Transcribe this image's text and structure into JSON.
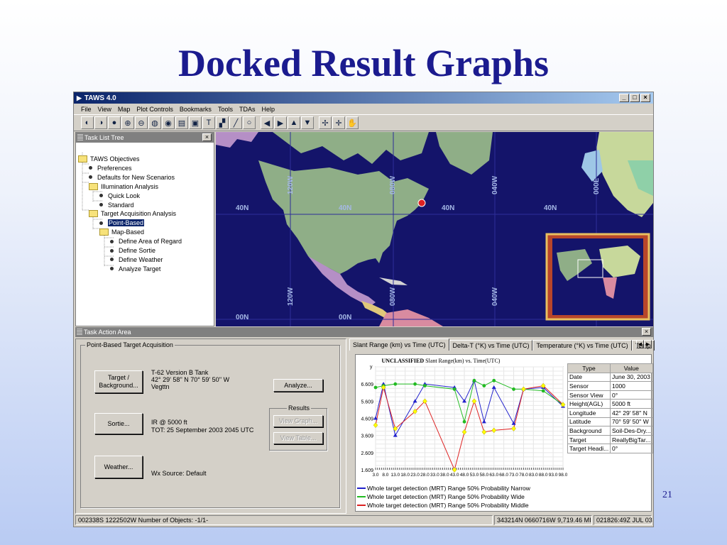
{
  "slide": {
    "title": "Docked Result Graphs",
    "number": "21"
  },
  "window": {
    "title": "TAWS 4.0",
    "controls": [
      "_",
      "□",
      "×"
    ],
    "menu": [
      "File",
      "View",
      "Map",
      "Plot Controls",
      "Bookmarks",
      "Tools",
      "TDAs",
      "Help"
    ]
  },
  "task_tree": {
    "title": "Task List Tree",
    "close": "×",
    "nodes": [
      {
        "label": "TAWS Objectives",
        "kind": "folder",
        "indent": 0
      },
      {
        "label": "Preferences",
        "kind": "leaf",
        "indent": 1
      },
      {
        "label": "Defaults for New Scenarios",
        "kind": "leaf",
        "indent": 1
      },
      {
        "label": "Illumination Analysis",
        "kind": "folder",
        "indent": 1
      },
      {
        "label": "Quick Look",
        "kind": "leaf",
        "indent": 2
      },
      {
        "label": "Standard",
        "kind": "leaf",
        "indent": 2
      },
      {
        "label": "Target Acquisition Analysis",
        "kind": "folder",
        "indent": 1
      },
      {
        "label": "Point-Based",
        "kind": "leaf",
        "indent": 2,
        "selected": true
      },
      {
        "label": "Map-Based",
        "kind": "folder",
        "indent": 2
      },
      {
        "label": "Define Area of Regard",
        "kind": "leaf",
        "indent": 3
      },
      {
        "label": "Define Sortie",
        "kind": "leaf",
        "indent": 3
      },
      {
        "label": "Define Weather",
        "kind": "leaf",
        "indent": 3
      },
      {
        "label": "Analyze Target",
        "kind": "leaf",
        "indent": 3
      }
    ]
  },
  "map": {
    "labels_lat": [
      "40N",
      "40N",
      "40N",
      "40N",
      "00N",
      "00N"
    ],
    "labels_lon": [
      "120W",
      "080W",
      "040W",
      "000E",
      "120W",
      "080W",
      "040W"
    ],
    "colors": {
      "ocean": "#14146a",
      "north_america": "#8fae87",
      "mexico": "#b58fc6"
    }
  },
  "action_area": {
    "title": "Task Action Area",
    "close": "×",
    "group_title": "Point-Based Target Acquisition",
    "target_button": "Target / Background...",
    "target_info": [
      "T-62 Version B Tank",
      "42° 29' 58'' N  70° 59' 50'' W",
      "Vegttn"
    ],
    "analyze_button": "Analyze...",
    "results_title": "Results",
    "view_graph": "View Graph...",
    "view_table": "View Table...",
    "sortie_button": "Sortie...",
    "sortie_info": [
      "IR @   5000 ft",
      "TOT: 25 September 2003 2045 UTC"
    ],
    "weather_button": "Weather...",
    "weather_info": "Wx Source: Default"
  },
  "graph_panel": {
    "tabs": [
      "Slant Range (km) vs Time (UTC)",
      "Delta-T (°K) vs Time (UTC)",
      "Temperature (°K) vs Time (UTC)",
      "Temp"
    ],
    "plot_title_bold": "UNCLASSIFIED",
    "plot_title_rest": " Slant Range(km) vs. Time(UTC)",
    "table_headers": [
      "Type",
      "Value"
    ],
    "table_rows": [
      [
        "Date",
        "June 30, 2003"
      ],
      [
        "Sensor",
        "1000"
      ],
      [
        "Sensor View",
        "0°"
      ],
      [
        "Height(AGL)",
        "5000 ft"
      ],
      [
        "Longitude",
        "42° 29' 58'' N"
      ],
      [
        "Latitude",
        "70° 59' 50'' W"
      ],
      [
        "Background",
        "Soil-Des-Dry..."
      ],
      [
        "Target",
        "ReallyBigTar..."
      ],
      [
        "Target Headi...",
        "0°"
      ]
    ]
  },
  "chart_data": {
    "type": "line",
    "xlabel": "",
    "ylabel": "",
    "y_axis_label": "y",
    "ylim": [
      1.609,
      7.609
    ],
    "yticks": [
      "6.609",
      "5.609",
      "4.609",
      "3.609",
      "2.609",
      "1.609"
    ],
    "xticks": [
      "3.0",
      "8.0",
      "13.0",
      "18.0",
      "23.0",
      "28.0",
      "33.0",
      "38.0",
      "43.0",
      "48.0",
      "53.0",
      "58.0",
      "63.0",
      "68.0",
      "73.0",
      "78.0",
      "83.0",
      "88.0",
      "93.0",
      "98.0"
    ],
    "x": [
      3,
      7,
      13,
      23,
      28,
      43,
      48,
      53,
      58,
      63,
      73,
      78,
      88,
      98
    ],
    "series": [
      {
        "name": "Whole target detection (MRT) Range  50% Probability  Narrow",
        "color": "#2222cc",
        "values": [
          4.609,
          6.609,
          3.609,
          5.609,
          6.609,
          6.409,
          5.609,
          6.809,
          4.409,
          6.409,
          4.309,
          6.309,
          6.409,
          5.309
        ]
      },
      {
        "name": "Whole target detection (MRT) Range  50% Probability  Wide",
        "color": "#22bb22",
        "values": [
          6.409,
          6.509,
          6.609,
          6.609,
          6.509,
          6.309,
          4.409,
          6.809,
          6.509,
          6.809,
          6.309,
          6.309,
          6.209,
          5.409
        ]
      },
      {
        "name": "Whole target detection (MRT) Range  50% Probability  Middle",
        "color": "#dd2222",
        "values": [
          4.209,
          6.409,
          4.009,
          5.009,
          5.609,
          1.609,
          3.809,
          5.609,
          3.809,
          3.909,
          4.009,
          6.309,
          6.509,
          5.409
        ]
      }
    ],
    "marker_color": "#ffff00",
    "grid": true,
    "legend": "bottom"
  },
  "status": {
    "left": "002338S 1222502W  Number of Objects: -1/1-",
    "mid": "343214N 0660716W  9,719.46 MI",
    "right": "021826:49Z JUL 03"
  }
}
